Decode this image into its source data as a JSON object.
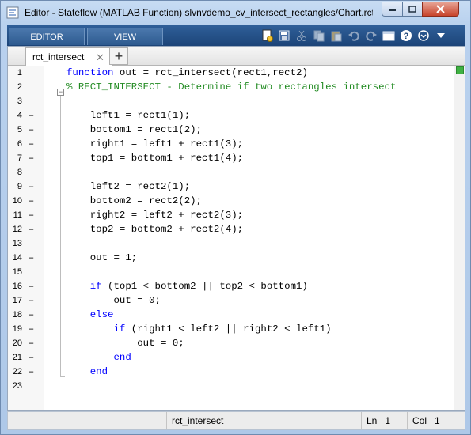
{
  "window": {
    "title": "Editor - Stateflow (MATLAB Function) slvnvdemo_cv_intersect_rectangles/Chart.rct_i..."
  },
  "toolstrip": {
    "tabs": [
      {
        "label": "EDITOR"
      },
      {
        "label": "VIEW"
      }
    ],
    "icons": [
      "new-icon",
      "save-icon",
      "cut-icon",
      "copy-icon",
      "paste-icon",
      "undo-icon",
      "redo-icon",
      "window-icon",
      "help-icon",
      "options-icon",
      "collapse-icon"
    ]
  },
  "document_tab": {
    "label": "rct_intersect",
    "close_symbol": "✕",
    "add_symbol": "+"
  },
  "code": {
    "line_numbers": [
      "1",
      "2",
      "3",
      "4",
      "5",
      "6",
      "7",
      "8",
      "9",
      "10",
      "11",
      "12",
      "13",
      "14",
      "15",
      "16",
      "17",
      "18",
      "19",
      "20",
      "21",
      "22",
      "23"
    ],
    "lines": [
      "function out = rct_intersect(rect1,rect2)",
      "% RECT_INTERSECT - Determine if two rectangles intersect",
      "",
      "    left1 = rect1(1);",
      "    bottom1 = rect1(2);",
      "    right1 = left1 + rect1(3);",
      "    top1 = bottom1 + rect1(4);",
      "",
      "    left2 = rect2(1);",
      "    bottom2 = rect2(2);",
      "    right2 = left2 + rect2(3);",
      "    top2 = bottom2 + rect2(4);",
      "",
      "    out = 1;",
      "",
      "    if (top1 < bottom2 || top2 < bottom1)",
      "        out = 0;",
      "    else",
      "        if (right1 < left2 || right2 < left1)",
      "            out = 0;",
      "        end",
      "    end",
      ""
    ],
    "executable_marker": "–"
  },
  "statusbar": {
    "function_name": "rct_intersect",
    "ln_label": "Ln",
    "ln_value": "1",
    "col_label": "Col",
    "col_value": "1"
  },
  "colors": {
    "keyword": "#0000ff",
    "comment": "#228b22",
    "toolstrip": "#1c4478",
    "status_ok": "#3fb142"
  }
}
